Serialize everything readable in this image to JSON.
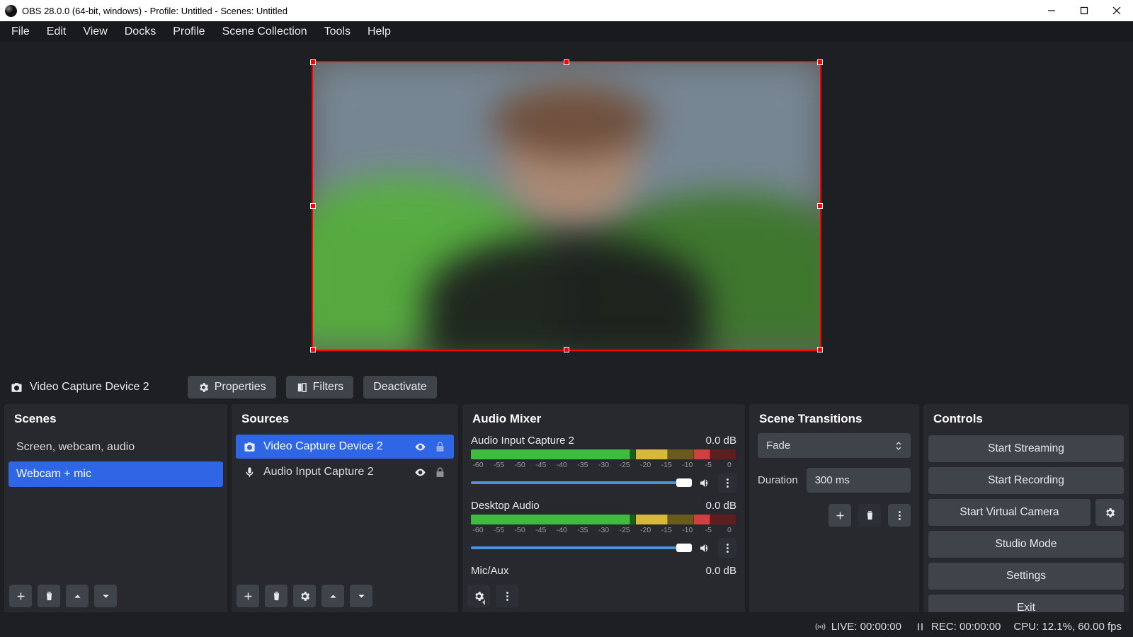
{
  "title": "OBS 28.0.0 (64-bit, windows) - Profile: Untitled - Scenes: Untitled",
  "menu": [
    "File",
    "Edit",
    "View",
    "Docks",
    "Profile",
    "Scene Collection",
    "Tools",
    "Help"
  ],
  "source_toolbar": {
    "selected": "Video Capture Device 2",
    "properties": "Properties",
    "filters": "Filters",
    "deactivate": "Deactivate"
  },
  "docks": {
    "scenes": {
      "title": "Scenes",
      "items": [
        "Screen, webcam, audio",
        "Webcam + mic"
      ],
      "selected": 1
    },
    "sources": {
      "title": "Sources",
      "items": [
        {
          "name": "Video Capture Device 2",
          "icon": "camera",
          "selected": true,
          "visible": true,
          "locked": false
        },
        {
          "name": "Audio Input Capture 2",
          "icon": "mic",
          "selected": false,
          "visible": true,
          "locked": false
        }
      ]
    },
    "mixer": {
      "title": "Audio Mixer",
      "ticks": [
        "-60",
        "-55",
        "-50",
        "-45",
        "-40",
        "-35",
        "-30",
        "-25",
        "-20",
        "-15",
        "-10",
        "-5",
        "0"
      ],
      "channels": [
        {
          "name": "Audio Input Capture 2",
          "db": "0.0 dB"
        },
        {
          "name": "Desktop Audio",
          "db": "0.0 dB"
        },
        {
          "name": "Mic/Aux",
          "db": "0.0 dB"
        }
      ]
    },
    "transitions": {
      "title": "Scene Transitions",
      "current": "Fade",
      "duration_label": "Duration",
      "duration_value": "300 ms"
    },
    "controls": {
      "title": "Controls",
      "buttons": [
        "Start Streaming",
        "Start Recording",
        "Start Virtual Camera",
        "Studio Mode",
        "Settings",
        "Exit"
      ]
    }
  },
  "status": {
    "live": "LIVE: 00:00:00",
    "rec": "REC: 00:00:00",
    "cpu": "CPU: 12.1%, 60.00 fps"
  }
}
